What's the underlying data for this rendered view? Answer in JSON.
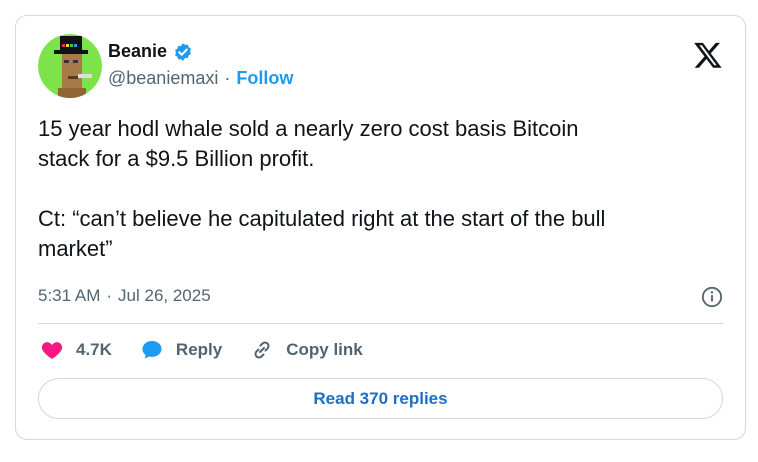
{
  "author": {
    "name": "Beanie",
    "handle": "@beaniemaxi",
    "separator": "·",
    "follow_label": "Follow",
    "verified_color": "#1d9bf0"
  },
  "tweet": {
    "text": "15 year hodl whale sold a nearly zero cost basis Bitcoin\nstack for a $9.5 Billion profit.\n\nCt: “can’t believe he capitulated right at the start of the bull\nmarket”",
    "time": "5:31 AM",
    "separator": "·",
    "date": "Jul 26, 2025"
  },
  "actions": {
    "like_count": "4.7K",
    "reply_label": "Reply",
    "copy_link_label": "Copy link"
  },
  "read_replies_label": "Read 370 replies",
  "colors": {
    "like": "#f91880",
    "reply": "#1d9bf0",
    "link": "#1d6fc4",
    "avatar_bg": "#7de34a"
  },
  "icons": {
    "brand": "x-logo-icon",
    "info": "info-icon",
    "like": "heart-icon",
    "reply": "speech-bubble-icon",
    "copy": "link-icon",
    "verified": "verified-badge-icon"
  }
}
